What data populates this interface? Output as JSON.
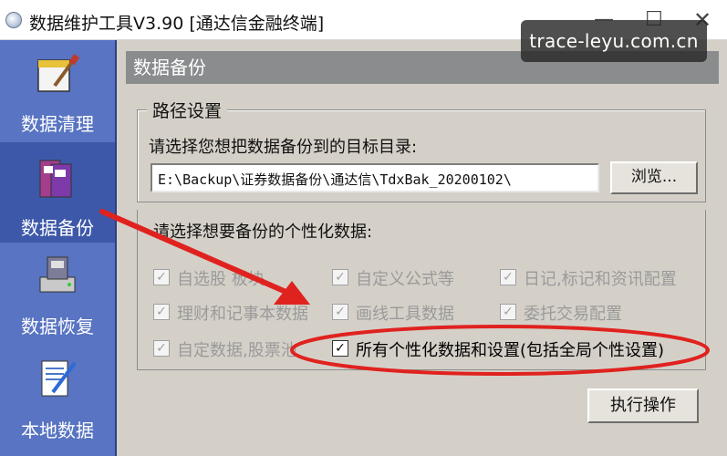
{
  "window": {
    "title": "数据维护工具V3.90 [通达信金融终端]",
    "controls": {
      "minimize": "—",
      "maximize": "☐",
      "close": "✕"
    }
  },
  "watermark": "trace-leyu.com.cn",
  "sidebar": {
    "items": [
      {
        "label": "数据清理",
        "icon": "cleanup-icon"
      },
      {
        "label": "数据备份",
        "icon": "backup-icon",
        "active": true
      },
      {
        "label": "数据恢复",
        "icon": "restore-icon"
      },
      {
        "label": "本地数据",
        "icon": "local-data-icon"
      }
    ]
  },
  "panel": {
    "header": "数据备份",
    "path_group": {
      "legend": "路径设置",
      "prompt": "请选择您想把数据备份到的目标目录:",
      "path_value": "E:\\Backup\\证券数据备份\\通达信\\TdxBak_20200102\\",
      "browse_label": "浏览..."
    },
    "data_prompt": "请选择想要备份的个性化数据:",
    "options": [
      {
        "label": "自选股 板块",
        "checked": true,
        "enabled": false
      },
      {
        "label": "自定义公式等",
        "checked": true,
        "enabled": false
      },
      {
        "label": "日记,标记和资讯配置",
        "checked": true,
        "enabled": false
      },
      {
        "label": "理财和记事本数据",
        "checked": true,
        "enabled": false
      },
      {
        "label": "画线工具数据",
        "checked": true,
        "enabled": false
      },
      {
        "label": "委托交易配置",
        "checked": true,
        "enabled": false
      },
      {
        "label": "自定数据,股票池",
        "checked": true,
        "enabled": false
      },
      {
        "label": "所有个性化数据和设置(包括全局个性设置)",
        "checked": true,
        "enabled": true
      }
    ],
    "execute_label": "执行操作"
  },
  "colors": {
    "sidebar_bg": "#5874c2",
    "sidebar_active": "#3d58a8",
    "header_bar": "#8a8c8e",
    "panel_bg": "#d4d0c8",
    "annotation_red": "#e0221f"
  }
}
